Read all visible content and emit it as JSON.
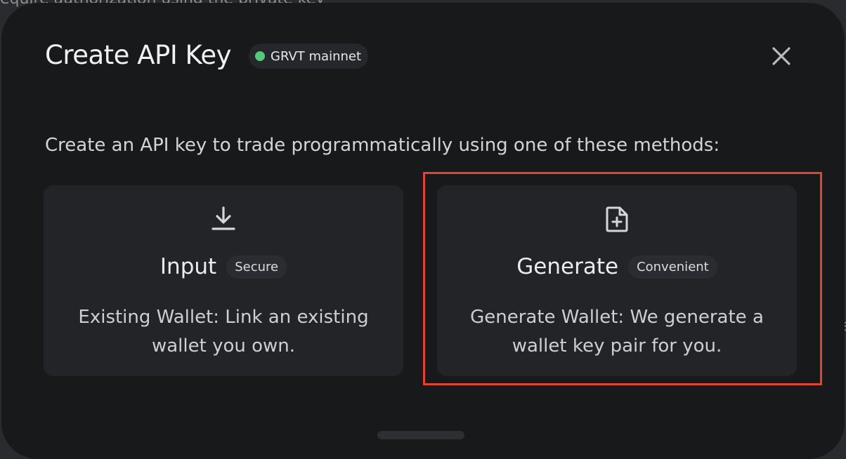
{
  "background": {
    "partial_text": "equire authorization using the private key",
    "edge_text": "s"
  },
  "modal": {
    "title": "Create API Key",
    "network_badge": {
      "label": "GRVT mainnet",
      "dot_color": "#53c97a"
    },
    "close_icon": "close-icon",
    "subtitle": "Create an API key to trade programmatically using one of these methods:",
    "options": [
      {
        "icon": "download-icon",
        "name": "Input",
        "tag": "Secure",
        "description": "Existing Wallet: Link an existing wallet you own."
      },
      {
        "icon": "file-plus-icon",
        "name": "Generate",
        "tag": "Convenient",
        "description": "Generate Wallet: We generate a wallet key pair for you.",
        "highlighted": true
      }
    ]
  },
  "colors": {
    "modal_bg": "#18191b",
    "card_bg": "#232428",
    "highlight_border": "#e2452a"
  }
}
